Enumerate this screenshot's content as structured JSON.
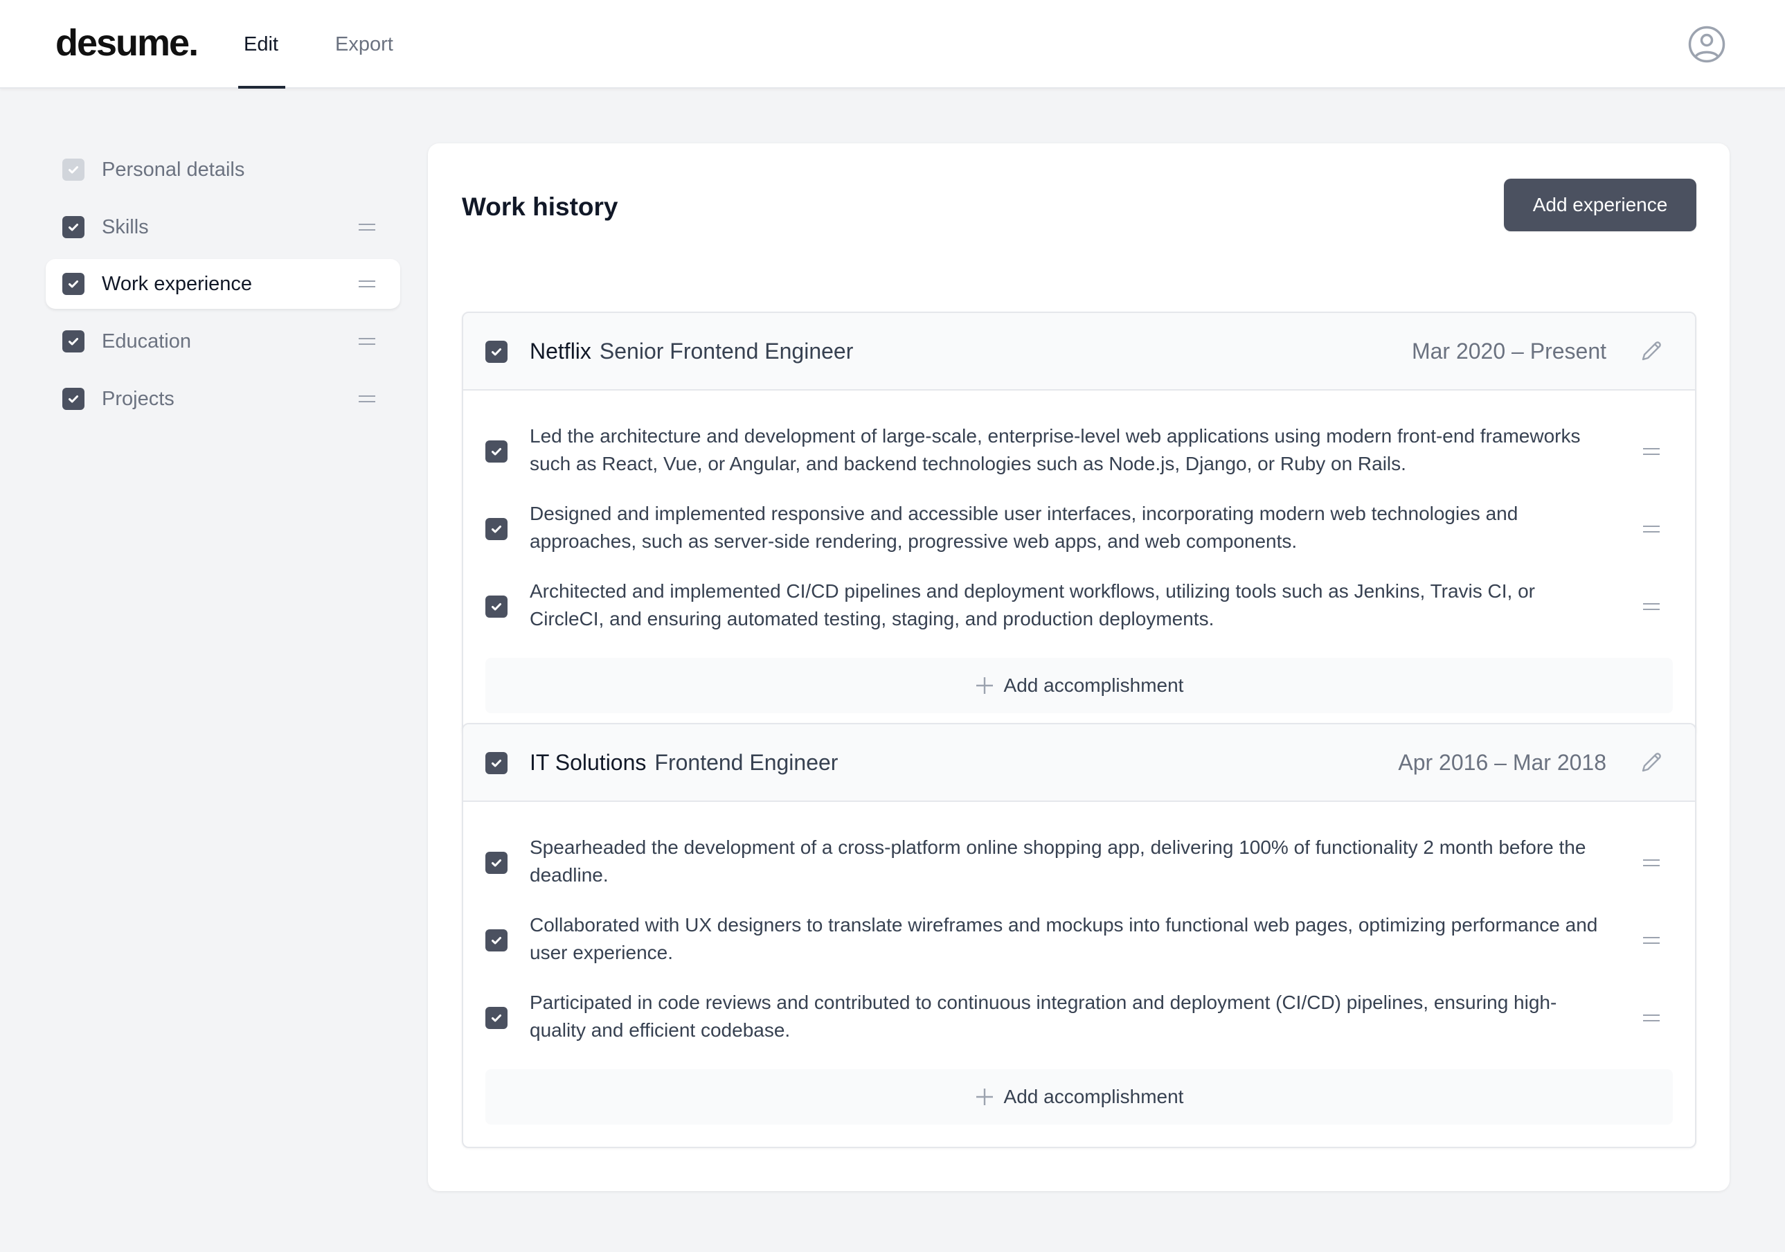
{
  "app": {
    "logo": "desume.",
    "tabs": [
      {
        "label": "Edit",
        "active": true
      },
      {
        "label": "Export",
        "active": false
      }
    ],
    "avatar_icon": "user-circle-icon"
  },
  "sidebar": {
    "items": [
      {
        "label": "Personal details",
        "checked": true,
        "disabled": true,
        "active": false
      },
      {
        "label": "Skills",
        "checked": true,
        "disabled": false,
        "active": false
      },
      {
        "label": "Work experience",
        "checked": true,
        "disabled": false,
        "active": true
      },
      {
        "label": "Education",
        "checked": true,
        "disabled": false,
        "active": false
      },
      {
        "label": "Projects",
        "checked": true,
        "disabled": false,
        "active": false
      }
    ]
  },
  "main": {
    "title": "Work history",
    "add_button": "Add experience",
    "jobs": [
      {
        "company": "Netflix",
        "role": "Senior Frontend Engineer",
        "dates": "Mar 2020 – Present",
        "checked": true,
        "accomplishments": [
          {
            "text": "Led the architecture and development of large-scale, enterprise-level web applications using modern front-end frameworks such as React, Vue, or Angular, and backend technologies such as Node.js, Django, or Ruby on Rails.",
            "checked": true
          },
          {
            "text": "Designed and implemented responsive and accessible user interfaces, incorporating modern web technologies and approaches, such as server-side rendering, progressive web apps, and web components.",
            "checked": true
          },
          {
            "text": "Architected and implemented CI/CD pipelines and deployment workflows, utilizing tools such as Jenkins, Travis CI, or CircleCI, and ensuring automated testing, staging, and production deployments.",
            "checked": true
          }
        ],
        "add_label": "Add accomplishment"
      },
      {
        "company": "IT Solutions",
        "role": "Frontend Engineer",
        "dates": "Apr 2016 – Mar 2018",
        "checked": true,
        "accomplishments": [
          {
            "text": "Spearheaded the development of a cross-platform online shopping app, delivering 100% of functionality 2 month before the deadline.",
            "checked": true
          },
          {
            "text": "Collaborated with UX designers to translate wireframes and mockups into functional web pages, optimizing performance and user experience.",
            "checked": true
          },
          {
            "text": "Participated in code reviews and contributed to continuous integration and deployment (CI/CD) pipelines, ensuring high-quality and efficient codebase.",
            "checked": true
          }
        ],
        "add_label": "Add accomplishment"
      }
    ]
  },
  "colors": {
    "background": "#f3f4f6",
    "checkbox": "#4b5160",
    "checkbox_disabled": "#d1d5db",
    "primary_button": "#4b5160",
    "muted_text": "#6b7280"
  }
}
